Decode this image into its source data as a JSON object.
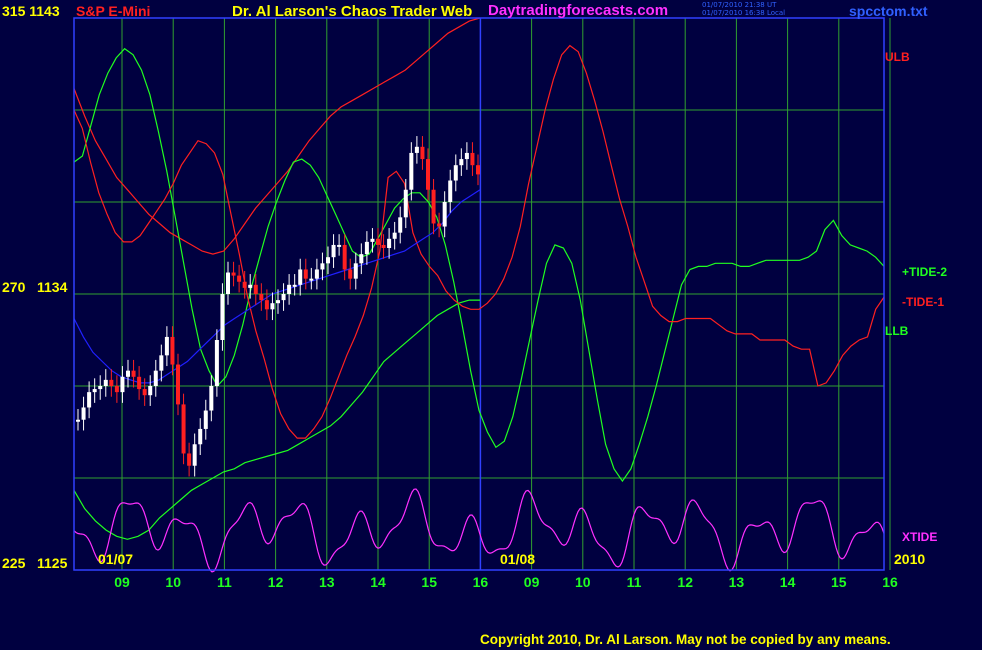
{
  "header": {
    "instrument_left": "315  1143",
    "instrument_name": "S&P E-Mini",
    "title": "Dr. Al Larson's Chaos Trader Web",
    "website": "Daytradingforecasts.com",
    "timestamp_ut": "01/07/2010 21:38 UT",
    "timestamp_local": "01/07/2010 16:38 Local",
    "file": "spcctom.txt"
  },
  "footer": {
    "copyright": "Copyright 2010, Dr. Al Larson. May not be copied by any means."
  },
  "colors": {
    "background": "#000040",
    "plot_border": "#3040ff",
    "grid": "#30a030",
    "ulb": "#ff2020",
    "llb": "#20ff20",
    "tide_plus": "#20ff20",
    "tide_minus": "#ff2020",
    "xtide": "#ff30ff",
    "ma": "#2020ff",
    "price_up": "#ffffff",
    "price_down": "#ff2020",
    "hour_labels": "#20ff20",
    "date_labels": "#ffff00"
  },
  "chart_data": {
    "type": "line",
    "title": "Dr. Al Larson's Chaos Trader Web",
    "instrument": "S&P E-Mini",
    "y_axis": {
      "ticks": [
        {
          "left": "315",
          "right": "1143",
          "value": 1143
        },
        {
          "left": "270",
          "right": "1134",
          "value": 1134
        },
        {
          "left": "225",
          "right": "1125",
          "value": 1125
        }
      ],
      "ylim": [
        1125,
        1143
      ]
    },
    "x_axis": {
      "hour_ticks": [
        "09",
        "10",
        "11",
        "12",
        "13",
        "14",
        "15",
        "16",
        "09",
        "10",
        "11",
        "12",
        "13",
        "14",
        "15",
        "16"
      ],
      "date_labels": [
        "01/07",
        "01/08",
        "2010"
      ],
      "current_time_divider_after_tick": 8
    },
    "grid": true,
    "series": [
      {
        "name": "ULB",
        "color": "#ff2020",
        "values": [
          1140.7,
          1139.8,
          1139.0,
          1138.4,
          1137.8,
          1137.4,
          1137.0,
          1136.6,
          1136.3,
          1136.0,
          1135.8,
          1135.6,
          1135.4,
          1135.3,
          1135.4,
          1135.8,
          1136.3,
          1136.8,
          1137.2,
          1137.6,
          1138.0,
          1138.5,
          1139.0,
          1139.4,
          1139.8,
          1140.1,
          1140.3,
          1140.5,
          1140.7,
          1140.9,
          1141.1,
          1141.3,
          1141.6,
          1141.9,
          1142.2,
          1142.5,
          1142.7,
          1142.9,
          1143.0
        ]
      },
      {
        "name": "LLB",
        "color": "#20ff20",
        "values": [
          1127.6,
          1127.0,
          1126.6,
          1126.3,
          1126.1,
          1126.0,
          1126.1,
          1126.3,
          1126.7,
          1127.0,
          1127.3,
          1127.6,
          1127.8,
          1128.0,
          1128.2,
          1128.3,
          1128.5,
          1128.6,
          1128.7,
          1128.8,
          1128.9,
          1129.1,
          1129.3,
          1129.5,
          1129.7,
          1130.0,
          1130.4,
          1130.8,
          1131.3,
          1131.8,
          1132.1,
          1132.4,
          1132.7,
          1133.0,
          1133.3,
          1133.5,
          1133.7,
          1133.8,
          1133.8
        ]
      },
      {
        "name": "+TIDE-2",
        "color": "#20ff20",
        "values": [
          1138.3,
          1138.5,
          1139.5,
          1140.5,
          1141.2,
          1141.7,
          1142.0,
          1141.8,
          1141.3,
          1140.5,
          1139.3,
          1138.0,
          1136.5,
          1135.0,
          1133.5,
          1132.2,
          1131.5,
          1131.0,
          1131.3,
          1132.0,
          1133.0,
          1134.2,
          1135.2,
          1136.2,
          1137.0,
          1137.7,
          1138.3,
          1138.4,
          1138.2,
          1137.8,
          1137.2,
          1136.6,
          1136.0,
          1135.4,
          1135.2,
          1135.3,
          1135.8,
          1136.3,
          1136.8,
          1137.1,
          1137.3,
          1137.3,
          1137.0,
          1136.5,
          1135.6,
          1134.4,
          1133.0,
          1131.5,
          1130.2,
          1129.5,
          1129.0,
          1129.2,
          1130.0,
          1131.2,
          1132.5,
          1133.8,
          1135.0,
          1135.6,
          1135.5,
          1135.0,
          1133.8,
          1132.2,
          1130.6,
          1129.1,
          1128.3,
          1127.9,
          1128.3,
          1129.1,
          1130.0,
          1131.0,
          1132.1,
          1133.2,
          1134.3,
          1134.8,
          1134.9,
          1134.9,
          1135.0,
          1135.0,
          1135.0,
          1134.9,
          1134.9,
          1135.0,
          1135.1,
          1135.1,
          1135.1,
          1135.1,
          1135.1,
          1135.2,
          1135.4,
          1136.1,
          1136.4,
          1135.9,
          1135.6,
          1135.5,
          1135.4,
          1135.2,
          1134.9
        ]
      },
      {
        "name": "-TIDE-1",
        "color": "#ff2020",
        "values": [
          1140.0,
          1139.4,
          1138.3,
          1137.3,
          1136.6,
          1136.0,
          1135.7,
          1135.7,
          1135.9,
          1136.3,
          1136.7,
          1137.1,
          1137.6,
          1138.2,
          1138.6,
          1139.0,
          1138.9,
          1138.6,
          1137.9,
          1136.6,
          1135.3,
          1133.9,
          1132.8,
          1131.9,
          1130.9,
          1130.1,
          1129.6,
          1129.3,
          1129.3,
          1129.6,
          1130.0,
          1130.6,
          1131.3,
          1132.0,
          1132.6,
          1133.3,
          1134.2,
          1135.4,
          1137.8,
          1138.0,
          1137.6,
          1136.0,
          1135.3,
          1134.9,
          1134.6,
          1134.1,
          1133.8,
          1133.6,
          1133.5,
          1133.5,
          1133.7,
          1134.0,
          1134.5,
          1135.2,
          1136.2,
          1137.6,
          1138.8,
          1140.0,
          1141.0,
          1141.8,
          1142.1,
          1141.9,
          1141.2,
          1140.3,
          1139.3,
          1138.2,
          1137.1,
          1136.2,
          1135.2,
          1134.4,
          1133.6,
          1133.3,
          1133.1,
          1133.1,
          1133.2,
          1133.2,
          1133.2,
          1133.2,
          1133.0,
          1132.8,
          1132.7,
          1132.7,
          1132.7,
          1132.5,
          1132.5,
          1132.5,
          1132.5,
          1132.3,
          1132.2,
          1132.2,
          1131.0,
          1131.1,
          1131.5,
          1132.0,
          1132.3,
          1132.5,
          1132.6,
          1133.5,
          1133.9
        ]
      },
      {
        "name": "XTIDE",
        "color": "#ff30ff"
      },
      {
        "name": "MA",
        "color": "#2020ff",
        "values": [
          1133.2,
          1132.6,
          1132.1,
          1131.8,
          1131.5,
          1131.3,
          1131.2,
          1131.1,
          1131.1,
          1131.2,
          1131.4,
          1131.6,
          1131.8,
          1132.1,
          1132.4,
          1132.7,
          1133.0,
          1133.2,
          1133.4,
          1133.6,
          1133.8,
          1134.0,
          1134.1,
          1134.2,
          1134.3,
          1134.4,
          1134.5,
          1134.6,
          1134.7,
          1134.8,
          1134.9,
          1135.0,
          1135.1,
          1135.2,
          1135.3,
          1135.4,
          1135.6,
          1135.8,
          1136.0,
          1136.3,
          1136.7,
          1137.0,
          1137.2,
          1137.4
        ]
      },
      {
        "name": "S&P E-Mini",
        "type": "price",
        "values": [
          1129.9,
          1130.3,
          1130.8,
          1130.9,
          1131.0,
          1131.2,
          1131.0,
          1130.8,
          1131.3,
          1131.5,
          1131.3,
          1130.9,
          1130.7,
          1131.0,
          1131.5,
          1132.0,
          1132.6,
          1131.7,
          1130.4,
          1128.8,
          1128.4,
          1129.1,
          1129.6,
          1130.2,
          1131.0,
          1132.5,
          1134.0,
          1134.7,
          1134.6,
          1134.4,
          1134.2,
          1134.3,
          1134.0,
          1133.8,
          1133.5,
          1133.7,
          1133.8,
          1134.0,
          1134.3,
          1134.3,
          1134.8,
          1134.5,
          1134.5,
          1134.8,
          1135.0,
          1135.2,
          1135.6,
          1135.6,
          1134.8,
          1134.5,
          1135.0,
          1135.3,
          1135.7,
          1135.8,
          1135.6,
          1135.5,
          1135.8,
          1136.0,
          1136.5,
          1137.4,
          1138.6,
          1138.8,
          1138.4,
          1137.4,
          1136.3,
          1136.2,
          1137.0,
          1137.7,
          1138.2,
          1138.4,
          1138.6,
          1138.2,
          1137.9
        ]
      }
    ],
    "series_labels": [
      "ULB",
      "+TIDE-2",
      "-TIDE-1",
      "LLB",
      "XTIDE"
    ]
  }
}
